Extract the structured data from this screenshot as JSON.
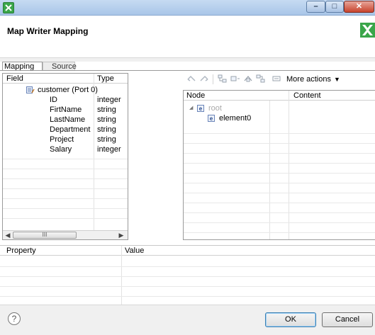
{
  "window": {
    "title": ""
  },
  "header": {
    "title": "Map Writer Mapping"
  },
  "tabs": [
    {
      "label": "Mapping",
      "active": true
    },
    {
      "label": "Source",
      "active": false
    }
  ],
  "left_table": {
    "headers": [
      "Field",
      "Type"
    ],
    "root": {
      "label": "customer (Port 0)"
    },
    "rows": [
      {
        "field": "ID",
        "type": "integer"
      },
      {
        "field": "FirtName",
        "type": "string"
      },
      {
        "field": "LastName",
        "type": "string"
      },
      {
        "field": "Department",
        "type": "string"
      },
      {
        "field": "Project",
        "type": "string"
      },
      {
        "field": "Salary",
        "type": "integer"
      }
    ]
  },
  "scrollbar": {
    "thumb_grip": "III"
  },
  "toolbar": {
    "icons": [
      "undo-icon",
      "redo-icon",
      "add-child-icon",
      "add-element-icon",
      "move-icon",
      "add-attribute-icon",
      "collapse-icon"
    ],
    "more_actions_label": "More actions",
    "more_arrow": "▼"
  },
  "right_table": {
    "headers": [
      "Node",
      "Content"
    ],
    "nodes": [
      {
        "label": "root",
        "disabled": true,
        "toggle": "◢",
        "icon_letter": "e"
      },
      {
        "label": "element0",
        "disabled": false,
        "toggle": "",
        "icon_letter": "e"
      }
    ]
  },
  "property_table": {
    "headers": [
      "Property",
      "Value"
    ]
  },
  "footer": {
    "help_symbol": "?",
    "ok_label": "OK",
    "cancel_label": "Cancel"
  },
  "colors": {
    "accent_green": "#3aa64a",
    "close_red": "#c8432c"
  }
}
